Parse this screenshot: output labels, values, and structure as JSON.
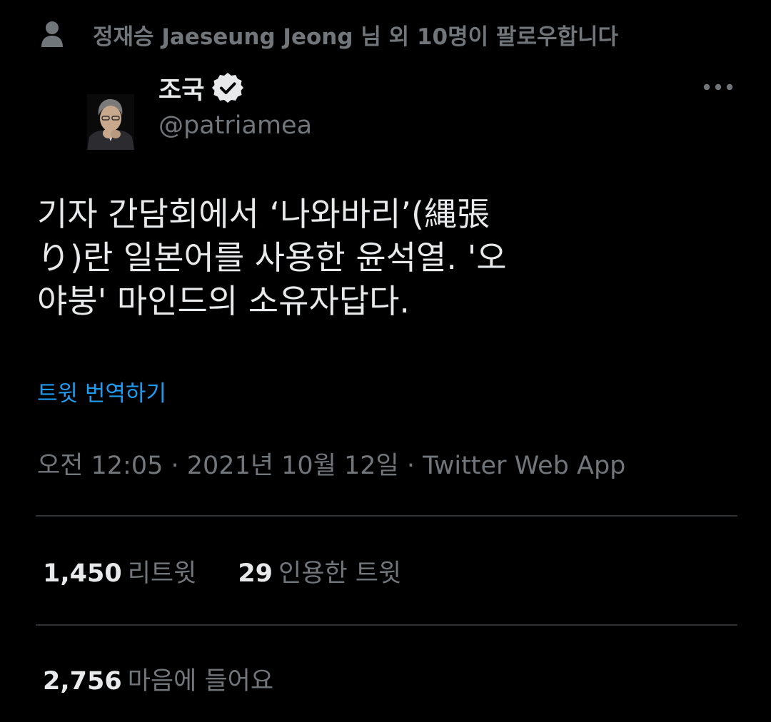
{
  "social_context": {
    "icon": "person-icon",
    "text": "정재승 Jaeseung Jeong 님 외 10명이 팔로우합니다"
  },
  "author": {
    "name": "조국",
    "verified": true,
    "verified_icon": "verified-badge-icon",
    "handle": "@patriamea",
    "avatar_icon": "avatar"
  },
  "more_icon": "more-icon",
  "tweet": {
    "lines": [
      "기자 간담회에서 ‘나와바리’(縄張",
      "り)란 일본어를 사용한 윤석열. '오",
      "야붕' 마인드의 소유자답다."
    ],
    "translate_label": "트윗 번역하기",
    "meta": "오전 12:05 · 2021년 10월 12일 · Twitter Web App"
  },
  "stats": {
    "retweets_count": "1,450",
    "retweets_label": "리트윗",
    "quotes_count": "29",
    "quotes_label": "인용한 트윗",
    "likes_count": "2,756",
    "likes_label": "마음에 들어요"
  },
  "colors": {
    "background": "#000000",
    "primary_text": "#e7e9ea",
    "secondary_text": "#71767b",
    "link": "#1d9bf0",
    "divider": "#2f3336"
  }
}
